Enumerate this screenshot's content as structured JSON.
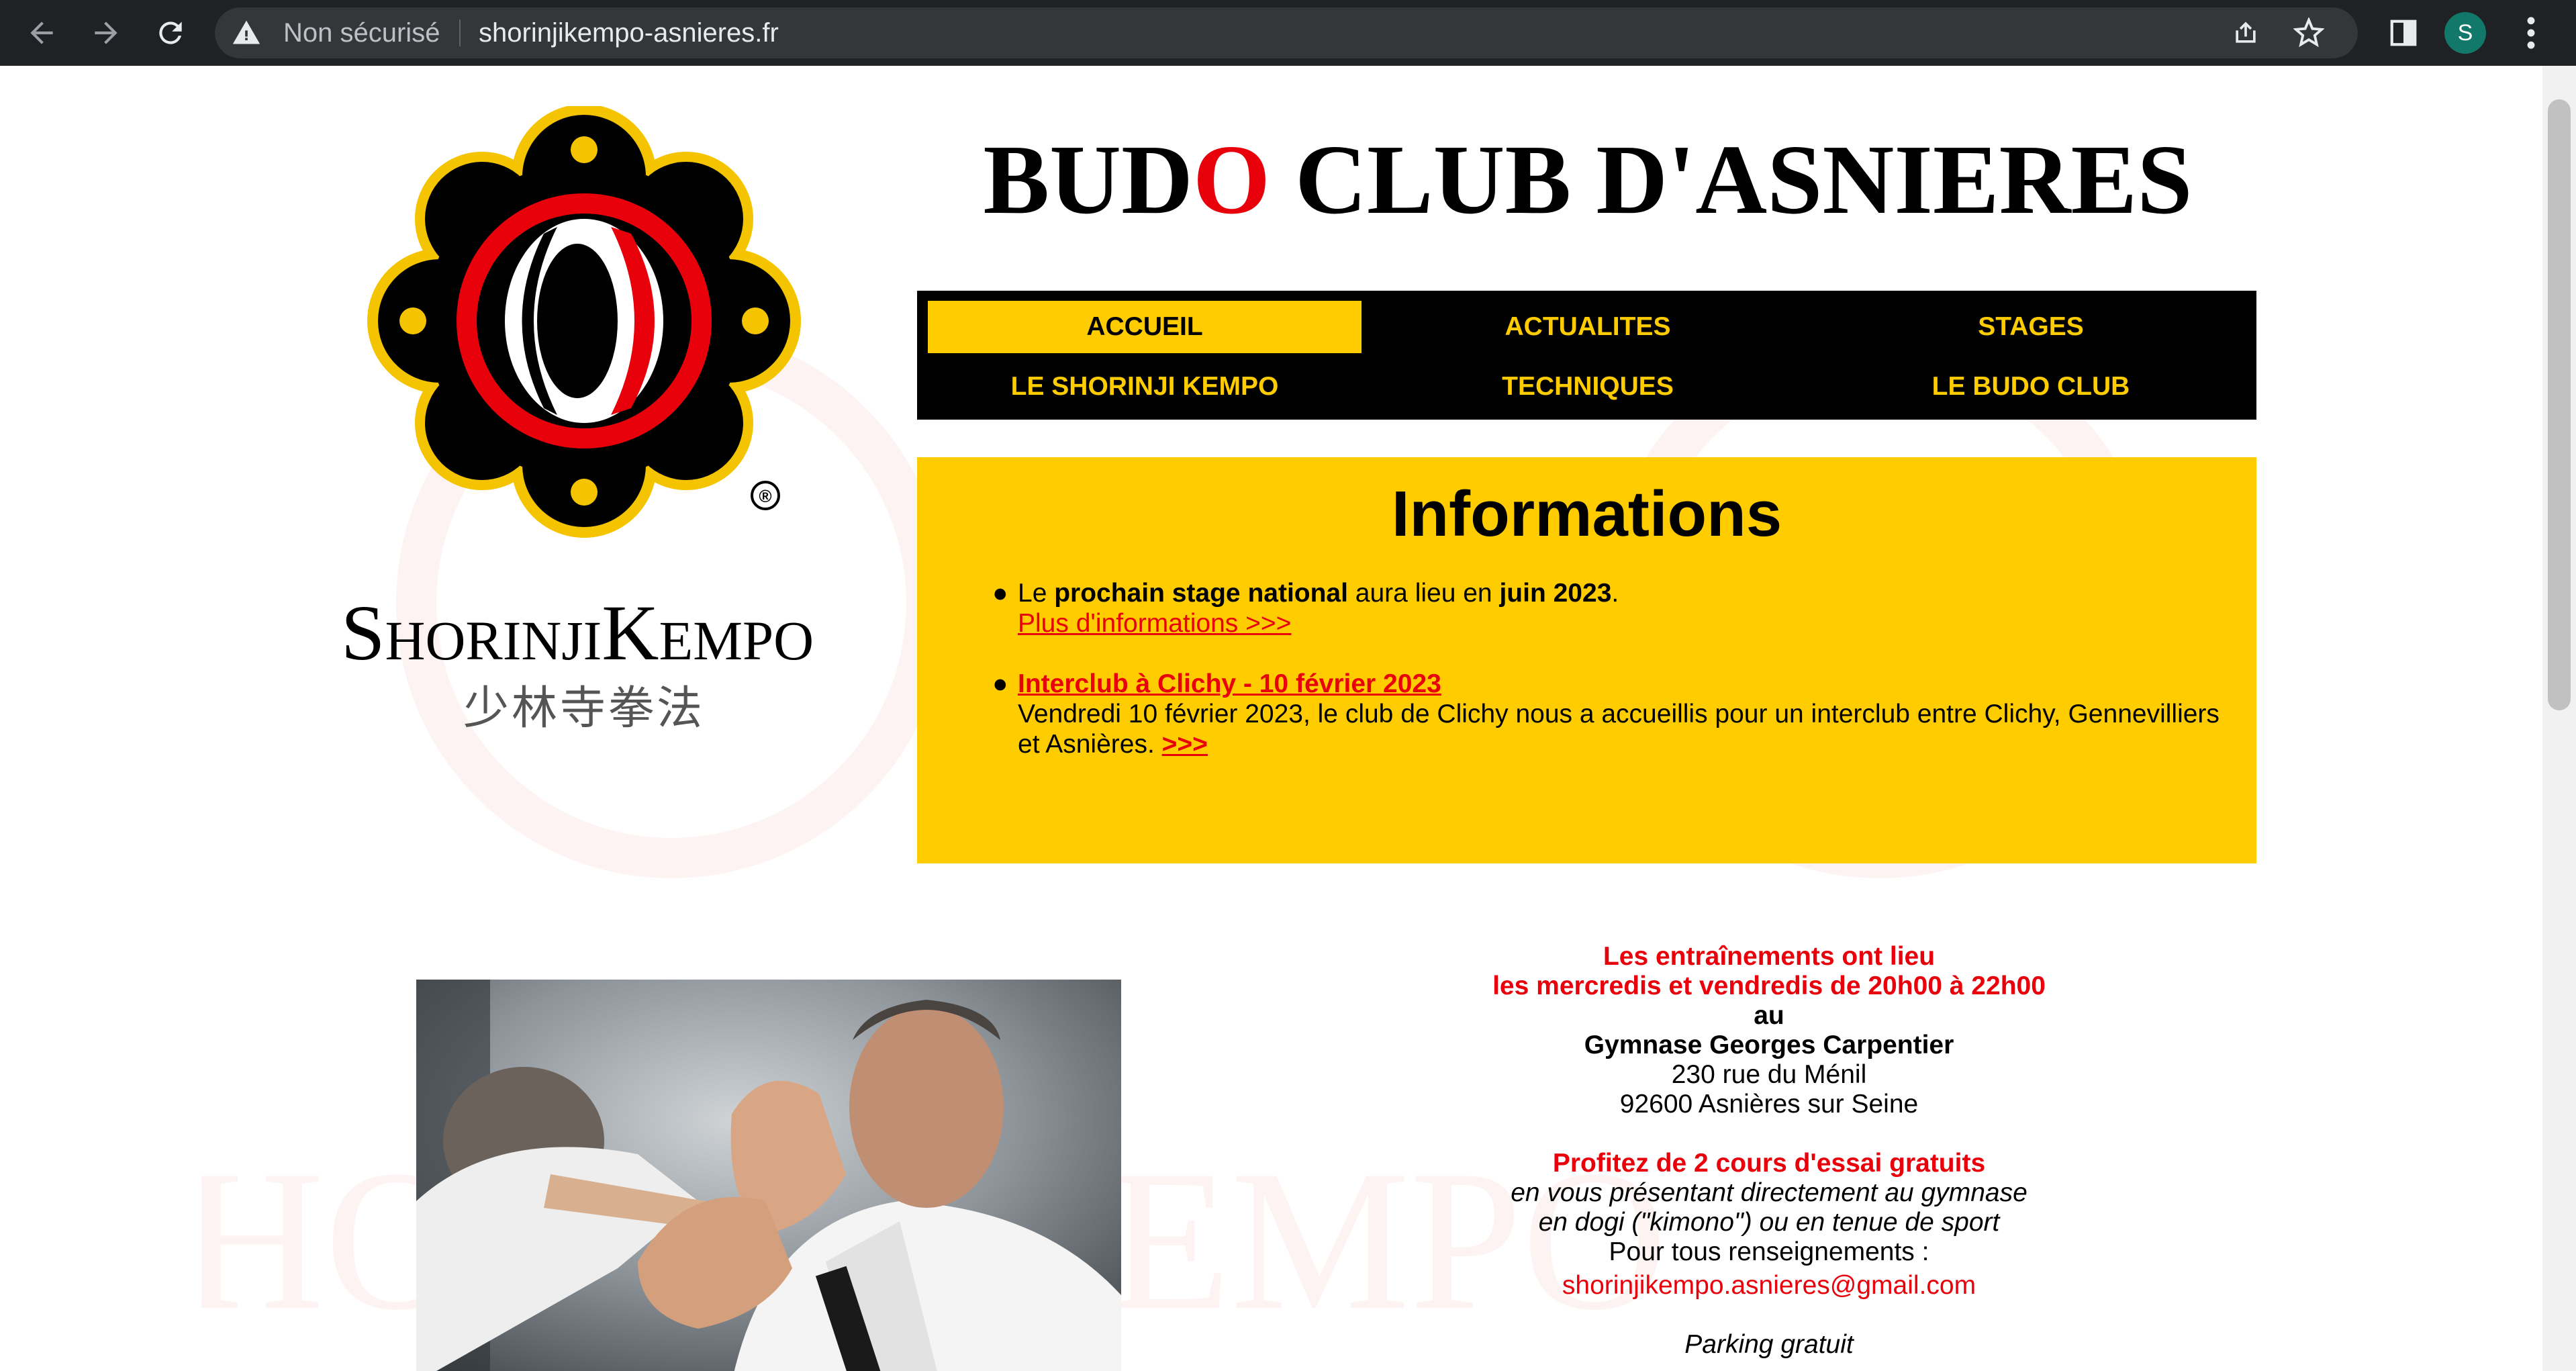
{
  "browser": {
    "security_label": "Non sécurisé",
    "url": "shorinjikempo-asnieres.fr",
    "profile_initial": "S",
    "icons": [
      "back-icon",
      "forward-icon",
      "reload-icon",
      "warning-icon",
      "share-icon",
      "star-icon",
      "side-panel-icon",
      "kebab-menu-icon"
    ]
  },
  "logo": {
    "wordmark": "ShorinjiKempo",
    "chinese": "少林寺拳法",
    "registered": "®",
    "colors": {
      "black": "#000000",
      "yellow": "#f5c400",
      "red": "#e8000b"
    }
  },
  "header": {
    "title_part1": "BUD",
    "title_o": "O",
    "title_part2": " CLUB D'ASNIERES"
  },
  "nav": {
    "items": [
      {
        "label": "ACCUEIL",
        "active": true
      },
      {
        "label": "ACTUALITES",
        "active": false
      },
      {
        "label": "STAGES",
        "active": false
      },
      {
        "label": "LE SHORINJI KEMPO",
        "active": false
      },
      {
        "label": "TECHNIQUES",
        "active": false
      },
      {
        "label": "LE BUDO CLUB",
        "active": false
      }
    ],
    "colors": {
      "bg": "#000000",
      "text": "#ffcc00",
      "active_bg": "#ffcc00",
      "active_text": "#000000"
    }
  },
  "info": {
    "title": "Informations",
    "item1": {
      "t1": "Le ",
      "t2": "prochain stage national",
      "t3": " aura lieu en ",
      "t4": "juin 2023",
      "t5": ".",
      "link": "Plus d'informations >>>"
    },
    "item2": {
      "link_title": "Interclub à Clichy - 10 février 2023",
      "text": "Vendredi 10 février 2023, le club de Clichy nous a accueillis pour un interclub entre Clichy, Gennevilliers et Asnières. ",
      "more": ">>>"
    },
    "bg_color": "#ffcc00"
  },
  "details": {
    "l1": "Les entraînements ont lieu",
    "l2": "les mercredis et vendredis de 20h00 à 22h00",
    "l3": "au",
    "l4": "Gymnase Georges Carpentier",
    "l5": "230 rue du Ménil",
    "l6": "92600 Asnières sur Seine",
    "l7": "Profitez de 2 cours d'essai gratuits",
    "l8": "en vous présentant directement au gymnase",
    "l9": "en dogi (\"kimono\") ou en tenue de sport",
    "l10": "Pour tous renseignements :",
    "email": "shorinjikempo.asnieres@gmail.com",
    "l11": "Parking gratuit",
    "accent_color": "#e8000b"
  }
}
